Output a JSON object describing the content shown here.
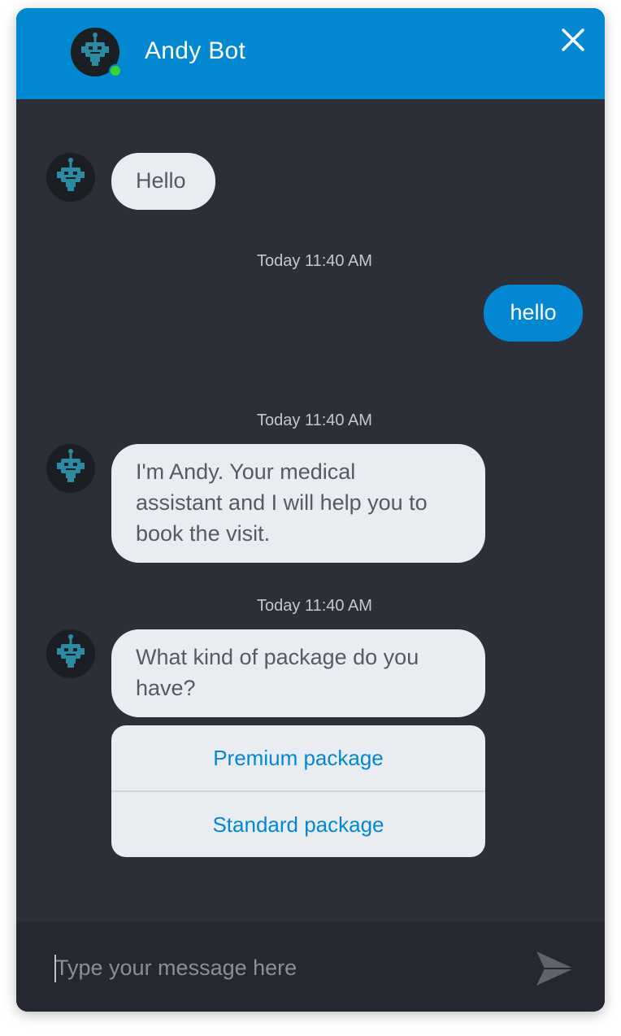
{
  "header": {
    "bot_name": "Andy Bot",
    "status": "online",
    "close_icon": "close-icon",
    "colors": {
      "background": "#0288d1",
      "online": "#3bd531"
    }
  },
  "messages": [
    {
      "sender": "bot",
      "text": "Hello"
    },
    {
      "timestamp": "Today 11:40 AM"
    },
    {
      "sender": "user",
      "text": "hello"
    },
    {
      "timestamp": "Today 11:40 AM"
    },
    {
      "sender": "bot",
      "lines": [
        "I'm Andy. Your medical",
        "assistant and I will help you to",
        "book the visit."
      ]
    },
    {
      "timestamp": "Today 11:40 AM"
    },
    {
      "sender": "bot",
      "lines": [
        "What kind of package do you",
        "have?"
      ]
    }
  ],
  "quick_replies": [
    "Premium package",
    "Standard package"
  ],
  "composer": {
    "placeholder": "Type your message here",
    "value": "",
    "send_icon": "send-icon"
  },
  "colors": {
    "chat_background": "#2c2f37",
    "bot_bubble": "#e9edf1",
    "user_bubble": "#0288d1",
    "option_text": "#0288d1"
  }
}
